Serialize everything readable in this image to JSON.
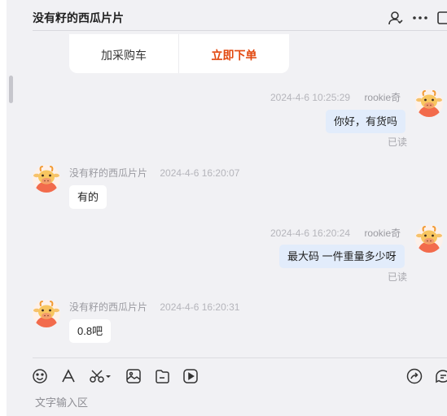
{
  "header": {
    "title": "没有籽的西瓜片片"
  },
  "order_card": {
    "add_to_cart": "加采购车",
    "buy_now": "立即下单"
  },
  "messages": [
    {
      "side": "self",
      "nickname": "rookie奇",
      "time": "2024-4-6 10:25:29",
      "text": "你好，有货吗",
      "status": "已读"
    },
    {
      "side": "other",
      "nickname": "没有籽的西瓜片片",
      "time": "2024-4-6 16:20:07",
      "text": "有的"
    },
    {
      "side": "self",
      "nickname": "rookie奇",
      "time": "2024-4-6 16:20:24",
      "text": "最大码 一件重量多少呀",
      "status": "已读"
    },
    {
      "side": "other",
      "nickname": "没有籽的西瓜片片",
      "time": "2024-4-6 16:20:31",
      "text": "0.8吧"
    }
  ],
  "composer": {
    "placeholder": "文字输入区"
  },
  "colors": {
    "accent": "#e2480f",
    "self_bubble": "#e2ecfb",
    "background": "#f1f1f4",
    "avatar_bg": "#f26b4c"
  },
  "icons": {
    "header": [
      "user-icon",
      "more-icon"
    ],
    "toolbar": [
      "emoji-icon",
      "font-icon",
      "scissors-icon",
      "image-icon",
      "file-icon",
      "video-icon",
      "share-icon",
      "quick-reply-icon"
    ]
  }
}
